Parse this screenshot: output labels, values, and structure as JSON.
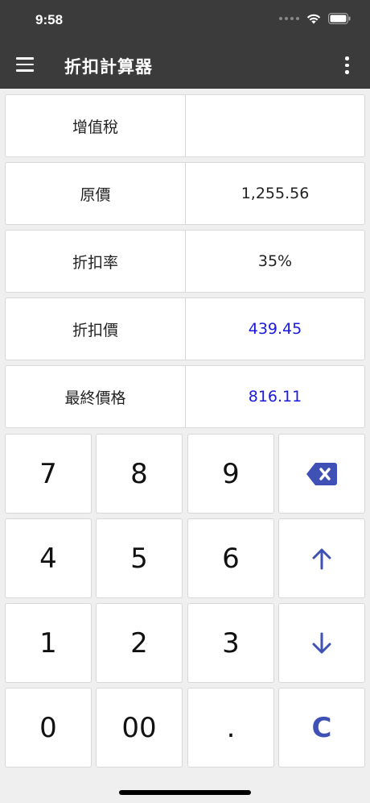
{
  "status": {
    "time": "9:58"
  },
  "appbar": {
    "title": "折扣計算器"
  },
  "fields": [
    {
      "label": "增值稅",
      "value": ""
    },
    {
      "label": "原價",
      "value": "1,255.56"
    },
    {
      "label": "折扣率",
      "value": "35%"
    },
    {
      "label": "折扣價",
      "value": "439.45"
    },
    {
      "label": "最終價格",
      "value": "816.11"
    }
  ],
  "keys": {
    "k7": "7",
    "k8": "8",
    "k9": "9",
    "k4": "4",
    "k5": "5",
    "k6": "6",
    "k1": "1",
    "k2": "2",
    "k3": "3",
    "k0": "0",
    "k00": "00",
    "kdot": ".",
    "clear": "C"
  },
  "icons": {
    "backspace": "backspace-icon",
    "up": "arrow-up-icon",
    "down": "arrow-down-icon"
  },
  "colors": {
    "accent": "#3f51b5",
    "result": "#1a1adc",
    "bar": "#3b3b3b"
  }
}
